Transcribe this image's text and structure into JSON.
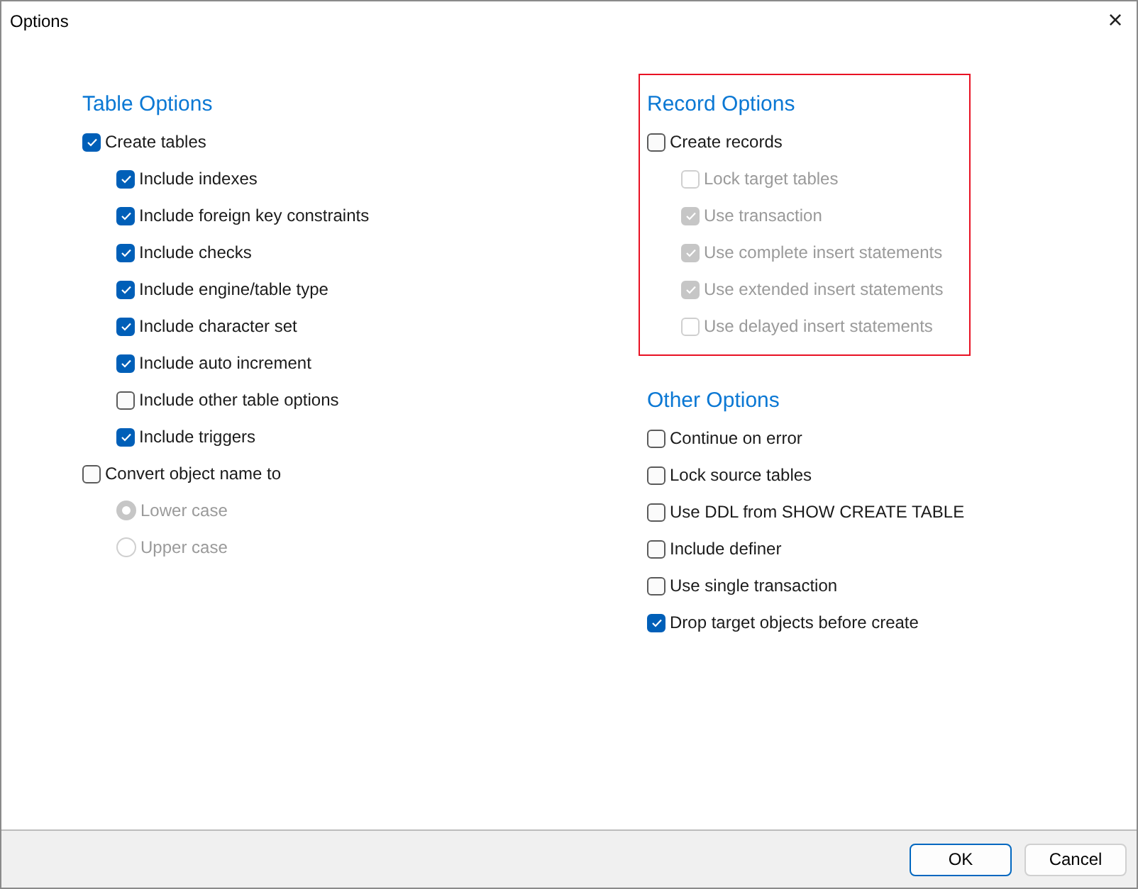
{
  "window": {
    "title": "Options",
    "close": "×"
  },
  "left_column": [
    {
      "title": "Table Options",
      "highlighted": false,
      "items": [
        {
          "kind": "checkbox",
          "label": "Create tables",
          "checked": true,
          "disabled": false,
          "children": [
            {
              "kind": "checkbox",
              "label": "Include indexes",
              "checked": true,
              "disabled": false
            },
            {
              "kind": "checkbox",
              "label": "Include foreign key constraints",
              "checked": true,
              "disabled": false
            },
            {
              "kind": "checkbox",
              "label": "Include checks",
              "checked": true,
              "disabled": false
            },
            {
              "kind": "checkbox",
              "label": "Include engine/table type",
              "checked": true,
              "disabled": false
            },
            {
              "kind": "checkbox",
              "label": "Include character set",
              "checked": true,
              "disabled": false
            },
            {
              "kind": "checkbox",
              "label": "Include auto increment",
              "checked": true,
              "disabled": false
            },
            {
              "kind": "checkbox",
              "label": "Include other table options",
              "checked": false,
              "disabled": false
            },
            {
              "kind": "checkbox",
              "label": "Include triggers",
              "checked": true,
              "disabled": false
            }
          ]
        },
        {
          "kind": "checkbox",
          "label": "Convert object name to",
          "checked": false,
          "disabled": false,
          "children": [
            {
              "kind": "radio",
              "label": "Lower case",
              "selected": true,
              "disabled": true
            },
            {
              "kind": "radio",
              "label": "Upper case",
              "selected": false,
              "disabled": true
            }
          ]
        }
      ]
    }
  ],
  "right_column": [
    {
      "title": "Record Options",
      "highlighted": true,
      "items": [
        {
          "kind": "checkbox",
          "label": "Create records",
          "checked": false,
          "disabled": false,
          "children": [
            {
              "kind": "checkbox",
              "label": "Lock target tables",
              "checked": false,
              "disabled": true
            },
            {
              "kind": "checkbox",
              "label": "Use transaction",
              "checked": true,
              "disabled": true
            },
            {
              "kind": "checkbox",
              "label": "Use complete insert statements",
              "checked": true,
              "disabled": true
            },
            {
              "kind": "checkbox",
              "label": "Use extended insert statements",
              "checked": true,
              "disabled": true
            },
            {
              "kind": "checkbox",
              "label": "Use delayed insert statements",
              "checked": false,
              "disabled": true
            }
          ]
        }
      ]
    },
    {
      "title": "Other Options",
      "highlighted": false,
      "items": [
        {
          "kind": "checkbox",
          "label": "Continue on error",
          "checked": false,
          "disabled": false
        },
        {
          "kind": "checkbox",
          "label": "Lock source tables",
          "checked": false,
          "disabled": false
        },
        {
          "kind": "checkbox",
          "label": "Use DDL from SHOW CREATE TABLE",
          "checked": false,
          "disabled": false
        },
        {
          "kind": "checkbox",
          "label": "Include definer",
          "checked": false,
          "disabled": false
        },
        {
          "kind": "checkbox",
          "label": "Use single transaction",
          "checked": false,
          "disabled": false
        },
        {
          "kind": "checkbox",
          "label": "Drop target objects before create",
          "checked": true,
          "disabled": false
        }
      ]
    }
  ],
  "buttons": [
    {
      "label": "OK",
      "default": true
    },
    {
      "label": "Cancel",
      "default": false
    }
  ]
}
